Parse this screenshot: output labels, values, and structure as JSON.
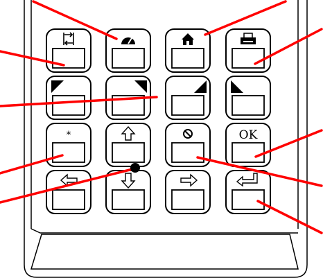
{
  "device": "keypad-remote",
  "callout_color": "#ff0000",
  "outline_color": "#000000",
  "keys": [
    {
      "row": 1,
      "col": 1,
      "icon": "swap-arrows-icon",
      "label": ""
    },
    {
      "row": 1,
      "col": 2,
      "icon": "speedometer-icon",
      "label": ""
    },
    {
      "row": 1,
      "col": 3,
      "icon": "home-icon",
      "label": ""
    },
    {
      "row": 1,
      "col": 4,
      "icon": "printer-icon",
      "label": ""
    },
    {
      "row": 2,
      "col": 1,
      "icon": "triangle-top-left-icon",
      "label": ""
    },
    {
      "row": 2,
      "col": 2,
      "icon": "triangle-top-right-icon",
      "label": ""
    },
    {
      "row": 2,
      "col": 3,
      "icon": "triangle-bottom-right-icon",
      "label": ""
    },
    {
      "row": 2,
      "col": 4,
      "icon": "triangle-bottom-left-icon",
      "label": ""
    },
    {
      "row": 3,
      "col": 1,
      "icon": "asterisk-icon",
      "label": "*"
    },
    {
      "row": 3,
      "col": 2,
      "icon": "arrow-up-icon",
      "label": ""
    },
    {
      "row": 3,
      "col": 3,
      "icon": "no-entry-icon",
      "label": ""
    },
    {
      "row": 3,
      "col": 4,
      "icon": "ok-text",
      "label": "OK"
    },
    {
      "row": 4,
      "col": 1,
      "icon": "arrow-left-icon",
      "label": ""
    },
    {
      "row": 4,
      "col": 2,
      "icon": "arrow-down-icon",
      "label": ""
    },
    {
      "row": 4,
      "col": 3,
      "icon": "arrow-right-icon",
      "label": ""
    },
    {
      "row": 4,
      "col": 4,
      "icon": "enter-return-icon",
      "label": ""
    }
  ],
  "callout_count": 10
}
